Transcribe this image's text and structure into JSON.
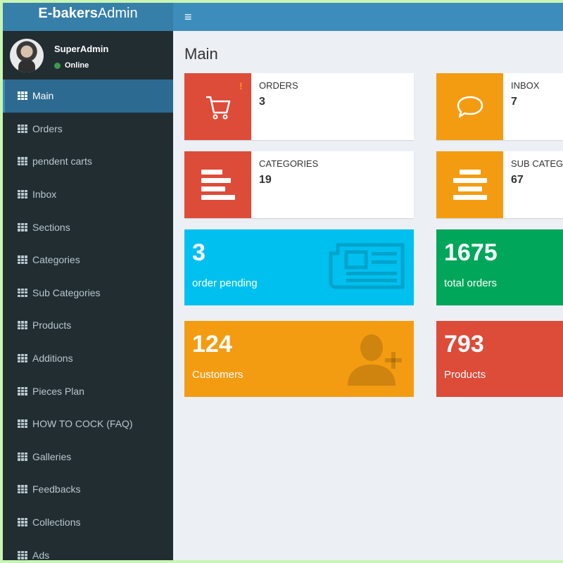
{
  "brand": {
    "bold": "E-bakers",
    "regular": "Admin"
  },
  "topbar": {
    "toggle_icon": "hamburger-icon"
  },
  "user": {
    "name": "SuperAdmin",
    "status": "Online",
    "status_color": "#3c9a4b"
  },
  "sidebar": {
    "items": [
      {
        "label": "Main",
        "active": true
      },
      {
        "label": "Orders"
      },
      {
        "label": "pendent carts"
      },
      {
        "label": "Inbox"
      },
      {
        "label": "Sections"
      },
      {
        "label": "Categories"
      },
      {
        "label": "Sub Categories"
      },
      {
        "label": "Products"
      },
      {
        "label": "Additions"
      },
      {
        "label": "Pieces Plan"
      },
      {
        "label": "HOW TO COCK (FAQ)"
      },
      {
        "label": "Galleries"
      },
      {
        "label": "Feedbacks"
      },
      {
        "label": "Collections"
      },
      {
        "label": "Ads"
      }
    ]
  },
  "main": {
    "title": "Main",
    "info_boxes": [
      {
        "label": "ORDERS",
        "value": "3",
        "icon": "cart-icon",
        "color": "#dd4b39"
      },
      {
        "label": "INBOX",
        "value": "7",
        "icon": "chat-bubble-icon",
        "color": "#f39c12"
      },
      {
        "label": "CATEGORIES",
        "value": "19",
        "icon": "align-left-icon",
        "color": "#dd4b39"
      },
      {
        "label": "SUB CATEGORIES",
        "value": "67",
        "icon": "align-center-icon",
        "color": "#f39c12"
      }
    ],
    "small_boxes": [
      {
        "value": "3",
        "label": "order pending",
        "icon": "newspaper-icon",
        "color": "#00c0ef"
      },
      {
        "value": "1675",
        "label": "total orders",
        "icon": "",
        "color": "#00a65a"
      },
      {
        "value": "124",
        "label": "Customers",
        "icon": "user-plus-icon",
        "color": "#f39c12"
      },
      {
        "value": "793",
        "label": "Products",
        "icon": "",
        "color": "#dd4b39"
      }
    ]
  }
}
